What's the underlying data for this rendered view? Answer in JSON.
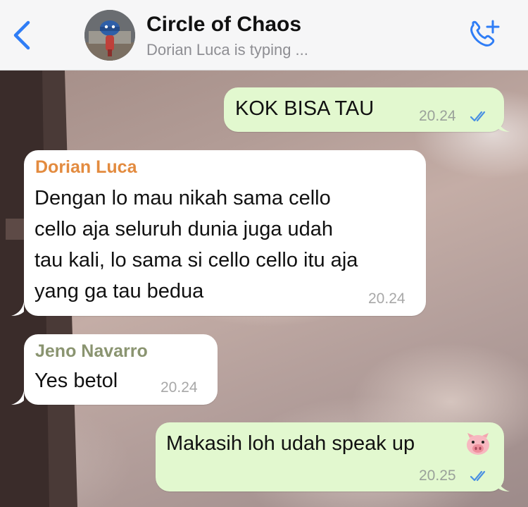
{
  "header": {
    "back_icon": "chevron-left-icon",
    "title": "Circle of Chaos",
    "status": "Dorian Luca is typing ...",
    "call_icon": "phone-add-icon",
    "accent_color": "#2f7df6"
  },
  "messages": [
    {
      "direction": "outgoing",
      "text": "KOK BISA TAU",
      "time": "20.24",
      "status_icon": "double-check-icon"
    },
    {
      "direction": "incoming",
      "sender": "Dorian Luca",
      "sender_color": "#e38b3f",
      "lines": [
        "Dengan lo mau nikah sama cello",
        "cello aja seluruh dunia juga udah",
        "tau kali, lo sama si cello cello itu aja",
        "yang ga tau bedua"
      ],
      "time": "20.24"
    },
    {
      "direction": "incoming",
      "sender": "Jeno Navarro",
      "sender_color": "#8a9470",
      "text": "Yes betol",
      "time": "20.24"
    },
    {
      "direction": "outgoing",
      "text": "Makasih loh udah speak up",
      "emoji": "pig-face-emoji",
      "time": "20.25",
      "status_icon": "double-check-icon"
    }
  ]
}
